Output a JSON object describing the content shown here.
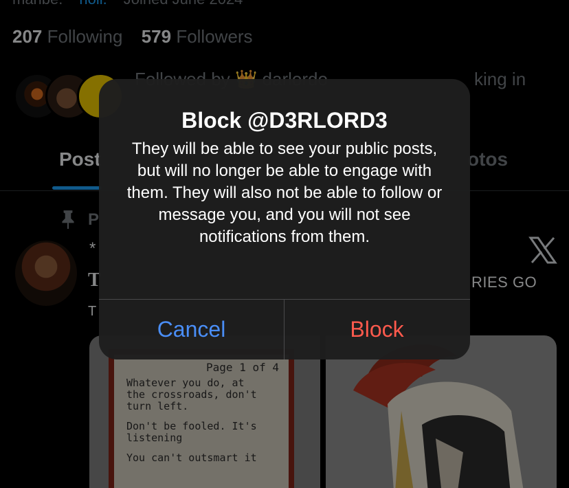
{
  "profile": {
    "meta_location": "maribe.",
    "meta_link": "holl.",
    "meta_joined": "Joined June 2024",
    "following_count": "207",
    "following_label": "Following",
    "followers_count": "579",
    "followers_label": "Followers",
    "followed_by_text": "Followed by 👑 darlordo",
    "followed_by_tail": "king in"
  },
  "tabs": [
    {
      "label": "Post"
    },
    {
      "label": "otos"
    }
  ],
  "post": {
    "pinned_label": "P",
    "asterisk": "*",
    "title_fragment": "T",
    "subtitle_fragment": "T",
    "right_fragment": "RIES GO",
    "book": {
      "page_label": "Page 1 of 4",
      "lines": [
        "Whatever you do, at\nthe crossroads, don't\nturn left.",
        "Don't be fooled. It's\nlistening",
        "You can't outsmart it"
      ]
    }
  },
  "alert": {
    "title": "Block @D3RLORD3",
    "message": "They will be able to see your public posts, but will no longer be able to engage with them. They will also not be able to follow or message you, and you will not see notifications from them.",
    "cancel_label": "Cancel",
    "block_label": "Block"
  },
  "colors": {
    "accent": "#1d9bf0",
    "cancel": "#4a8ef7",
    "block": "#ff5a4d",
    "alert_bg": "#1e1e1e"
  }
}
